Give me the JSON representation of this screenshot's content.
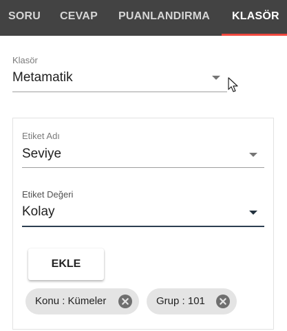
{
  "tabs": [
    {
      "label": "SORU",
      "active": false
    },
    {
      "label": "CEVAP",
      "active": false
    },
    {
      "label": "PUANLANDIRMA",
      "active": false
    },
    {
      "label": "KLASÖR",
      "active": true
    }
  ],
  "klasor": {
    "label": "Klasör",
    "value": "Metamatik"
  },
  "etiket_adi": {
    "label": "Etiket Adı",
    "value": "Seviye"
  },
  "etiket_degeri": {
    "label": "Etiket Değeri",
    "value": "Kolay"
  },
  "add_button": {
    "label": "EKLE"
  },
  "chips": [
    {
      "label": "Konu : Kümeler",
      "icon": "close-circle-icon"
    },
    {
      "label": "Grup : 101",
      "icon": "close-circle-icon"
    }
  ],
  "colors": {
    "tabbar_bg": "#434343",
    "tab_indicator": "#f0483e",
    "focused_underline": "#2c3e50",
    "chip_bg": "#e4e4e4"
  }
}
